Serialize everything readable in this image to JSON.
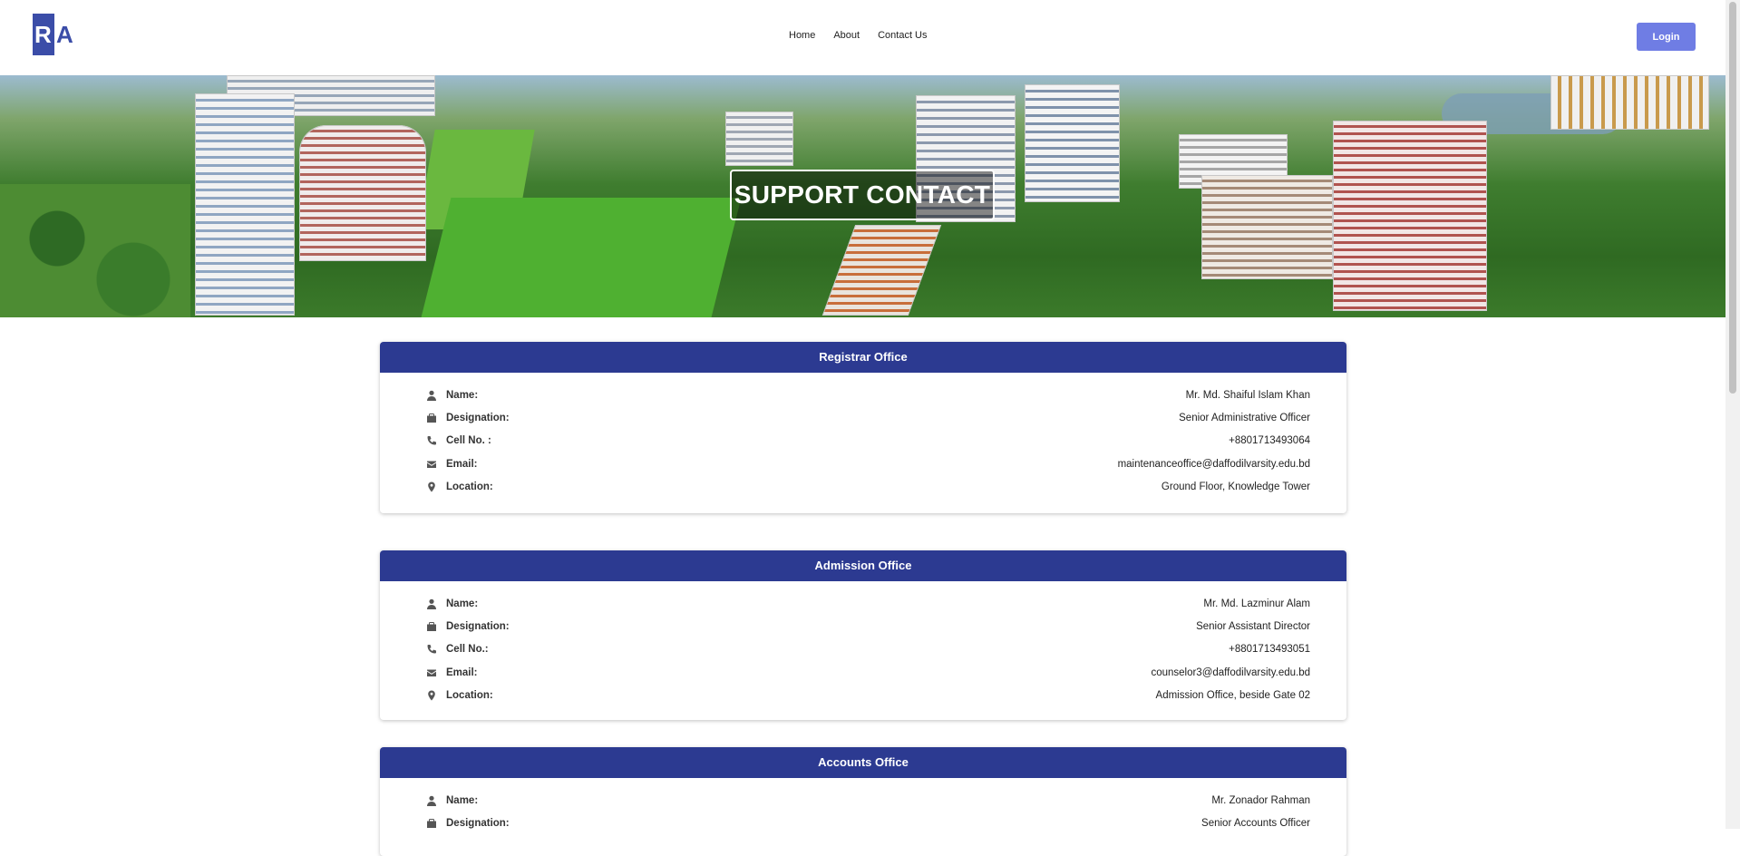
{
  "header": {
    "logo_letters": [
      "R",
      "A"
    ],
    "nav": [
      "Home",
      "About",
      "Contact Us"
    ],
    "login_label": "Login"
  },
  "hero": {
    "title": "SUPPORT CONTACT"
  },
  "offices": [
    {
      "title": "Registrar Office",
      "rows": [
        {
          "icon": "user-icon",
          "label": "Name:",
          "value": "Mr. Md. Shaiful Islam Khan"
        },
        {
          "icon": "briefcase-icon",
          "label": "Designation:",
          "value": "Senior Administrative Officer"
        },
        {
          "icon": "phone-icon",
          "label": "Cell No. :",
          "value": "+8801713493064"
        },
        {
          "icon": "envelope-icon",
          "label": "Email:",
          "value": "maintenanceoffice@daffodilvarsity.edu.bd"
        },
        {
          "icon": "location-pin-icon",
          "label": "Location:",
          "value": "Ground Floor, Knowledge Tower"
        }
      ]
    },
    {
      "title": "Admission Office",
      "rows": [
        {
          "icon": "user-icon",
          "label": "Name:",
          "value": "Mr. Md. Lazminur Alam"
        },
        {
          "icon": "briefcase-icon",
          "label": "Designation:",
          "value": "Senior Assistant Director"
        },
        {
          "icon": "phone-icon",
          "label": "Cell No.:",
          "value": "+8801713493051"
        },
        {
          "icon": "envelope-icon",
          "label": "Email:",
          "value": "counselor3@daffodilvarsity.edu.bd"
        },
        {
          "icon": "location-pin-icon",
          "label": "Location:",
          "value": "Admission Office, beside Gate 02"
        }
      ]
    },
    {
      "title": "Accounts Office",
      "rows": [
        {
          "icon": "user-icon",
          "label": "Name:",
          "value": "Mr. Zonador Rahman"
        },
        {
          "icon": "briefcase-icon",
          "label": "Designation:",
          "value": "Senior Accounts Officer"
        }
      ]
    }
  ],
  "colors": {
    "brand": "#3b4da8",
    "card_header": "#2c3a91",
    "login_button": "#6f7de4"
  }
}
